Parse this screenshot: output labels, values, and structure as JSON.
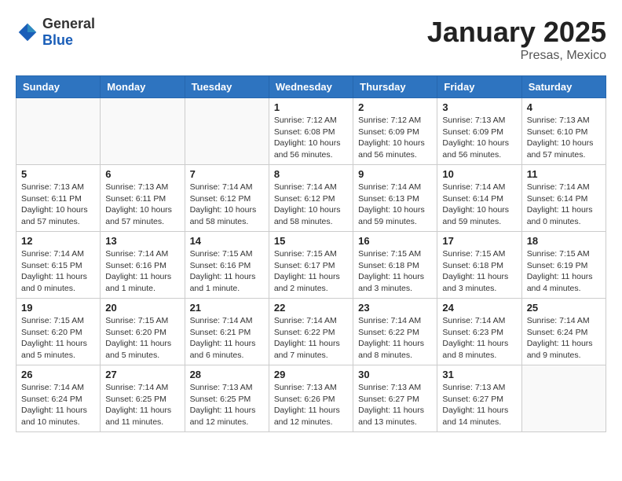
{
  "header": {
    "logo_general": "General",
    "logo_blue": "Blue",
    "month_title": "January 2025",
    "location": "Presas, Mexico"
  },
  "weekdays": [
    "Sunday",
    "Monday",
    "Tuesday",
    "Wednesday",
    "Thursday",
    "Friday",
    "Saturday"
  ],
  "weeks": [
    [
      {
        "day": "",
        "info": ""
      },
      {
        "day": "",
        "info": ""
      },
      {
        "day": "",
        "info": ""
      },
      {
        "day": "1",
        "info": "Sunrise: 7:12 AM\nSunset: 6:08 PM\nDaylight: 10 hours\nand 56 minutes."
      },
      {
        "day": "2",
        "info": "Sunrise: 7:12 AM\nSunset: 6:09 PM\nDaylight: 10 hours\nand 56 minutes."
      },
      {
        "day": "3",
        "info": "Sunrise: 7:13 AM\nSunset: 6:09 PM\nDaylight: 10 hours\nand 56 minutes."
      },
      {
        "day": "4",
        "info": "Sunrise: 7:13 AM\nSunset: 6:10 PM\nDaylight: 10 hours\nand 57 minutes."
      }
    ],
    [
      {
        "day": "5",
        "info": "Sunrise: 7:13 AM\nSunset: 6:11 PM\nDaylight: 10 hours\nand 57 minutes."
      },
      {
        "day": "6",
        "info": "Sunrise: 7:13 AM\nSunset: 6:11 PM\nDaylight: 10 hours\nand 57 minutes."
      },
      {
        "day": "7",
        "info": "Sunrise: 7:14 AM\nSunset: 6:12 PM\nDaylight: 10 hours\nand 58 minutes."
      },
      {
        "day": "8",
        "info": "Sunrise: 7:14 AM\nSunset: 6:12 PM\nDaylight: 10 hours\nand 58 minutes."
      },
      {
        "day": "9",
        "info": "Sunrise: 7:14 AM\nSunset: 6:13 PM\nDaylight: 10 hours\nand 59 minutes."
      },
      {
        "day": "10",
        "info": "Sunrise: 7:14 AM\nSunset: 6:14 PM\nDaylight: 10 hours\nand 59 minutes."
      },
      {
        "day": "11",
        "info": "Sunrise: 7:14 AM\nSunset: 6:14 PM\nDaylight: 11 hours\nand 0 minutes."
      }
    ],
    [
      {
        "day": "12",
        "info": "Sunrise: 7:14 AM\nSunset: 6:15 PM\nDaylight: 11 hours\nand 0 minutes."
      },
      {
        "day": "13",
        "info": "Sunrise: 7:14 AM\nSunset: 6:16 PM\nDaylight: 11 hours\nand 1 minute."
      },
      {
        "day": "14",
        "info": "Sunrise: 7:15 AM\nSunset: 6:16 PM\nDaylight: 11 hours\nand 1 minute."
      },
      {
        "day": "15",
        "info": "Sunrise: 7:15 AM\nSunset: 6:17 PM\nDaylight: 11 hours\nand 2 minutes."
      },
      {
        "day": "16",
        "info": "Sunrise: 7:15 AM\nSunset: 6:18 PM\nDaylight: 11 hours\nand 3 minutes."
      },
      {
        "day": "17",
        "info": "Sunrise: 7:15 AM\nSunset: 6:18 PM\nDaylight: 11 hours\nand 3 minutes."
      },
      {
        "day": "18",
        "info": "Sunrise: 7:15 AM\nSunset: 6:19 PM\nDaylight: 11 hours\nand 4 minutes."
      }
    ],
    [
      {
        "day": "19",
        "info": "Sunrise: 7:15 AM\nSunset: 6:20 PM\nDaylight: 11 hours\nand 5 minutes."
      },
      {
        "day": "20",
        "info": "Sunrise: 7:15 AM\nSunset: 6:20 PM\nDaylight: 11 hours\nand 5 minutes."
      },
      {
        "day": "21",
        "info": "Sunrise: 7:14 AM\nSunset: 6:21 PM\nDaylight: 11 hours\nand 6 minutes."
      },
      {
        "day": "22",
        "info": "Sunrise: 7:14 AM\nSunset: 6:22 PM\nDaylight: 11 hours\nand 7 minutes."
      },
      {
        "day": "23",
        "info": "Sunrise: 7:14 AM\nSunset: 6:22 PM\nDaylight: 11 hours\nand 8 minutes."
      },
      {
        "day": "24",
        "info": "Sunrise: 7:14 AM\nSunset: 6:23 PM\nDaylight: 11 hours\nand 8 minutes."
      },
      {
        "day": "25",
        "info": "Sunrise: 7:14 AM\nSunset: 6:24 PM\nDaylight: 11 hours\nand 9 minutes."
      }
    ],
    [
      {
        "day": "26",
        "info": "Sunrise: 7:14 AM\nSunset: 6:24 PM\nDaylight: 11 hours\nand 10 minutes."
      },
      {
        "day": "27",
        "info": "Sunrise: 7:14 AM\nSunset: 6:25 PM\nDaylight: 11 hours\nand 11 minutes."
      },
      {
        "day": "28",
        "info": "Sunrise: 7:13 AM\nSunset: 6:25 PM\nDaylight: 11 hours\nand 12 minutes."
      },
      {
        "day": "29",
        "info": "Sunrise: 7:13 AM\nSunset: 6:26 PM\nDaylight: 11 hours\nand 12 minutes."
      },
      {
        "day": "30",
        "info": "Sunrise: 7:13 AM\nSunset: 6:27 PM\nDaylight: 11 hours\nand 13 minutes."
      },
      {
        "day": "31",
        "info": "Sunrise: 7:13 AM\nSunset: 6:27 PM\nDaylight: 11 hours\nand 14 minutes."
      },
      {
        "day": "",
        "info": ""
      }
    ]
  ]
}
